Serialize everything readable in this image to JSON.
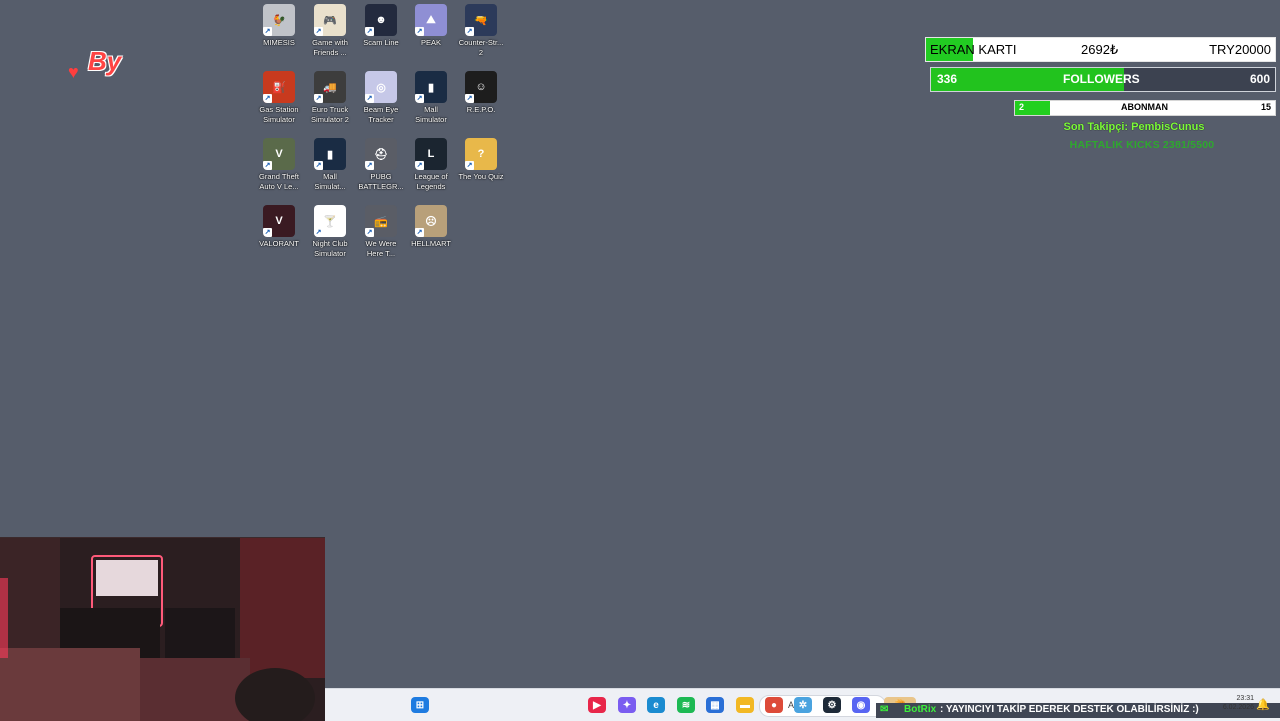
{
  "desktop": {
    "icons": [
      {
        "label": "MIMESIS",
        "icon": "mimesis-icon",
        "color": "#c0c3c9",
        "glyph": "🐓"
      },
      {
        "label": "Game with\nFriends ...",
        "icon": "game-with-friends-icon",
        "color": "#e9e0cc",
        "glyph": "🎮"
      },
      {
        "label": "Scam Line",
        "icon": "scam-line-icon",
        "color": "#232a3e",
        "glyph": "☻"
      },
      {
        "label": "PEAK",
        "icon": "peak-icon",
        "color": "#8f8fd4",
        "glyph": "⛰"
      },
      {
        "label": "Counter-Str...\n2",
        "icon": "counter-strike-icon",
        "color": "#2c3a5a",
        "glyph": "🔫"
      },
      {
        "label": "Gas Station\nSimulator",
        "icon": "gas-station-icon",
        "color": "#c83a1e",
        "glyph": "⛽"
      },
      {
        "label": "Euro Truck\nSimulator 2",
        "icon": "euro-truck-icon",
        "color": "#3d3d3d",
        "glyph": "🚚"
      },
      {
        "label": "Beam Eye\nTracker",
        "icon": "beam-eye-icon",
        "color": "#c6c8e8",
        "glyph": "◎"
      },
      {
        "label": "Mall\nSimulator",
        "icon": "mall-simulator-icon",
        "color": "#1a2c44",
        "glyph": "▮"
      },
      {
        "label": "R.E.P.O.",
        "icon": "repo-icon",
        "color": "#1d1d1d",
        "glyph": "☺"
      },
      {
        "label": "Grand Theft\nAuto V Le...",
        "icon": "gta-v-icon",
        "color": "#5a6a4a",
        "glyph": "V"
      },
      {
        "label": "Mall\nSimulat...",
        "icon": "mall-simulator-2-icon",
        "color": "#1a2c44",
        "glyph": "▮"
      },
      {
        "label": "PUBG\nBATTLEGR...",
        "icon": "pubg-icon",
        "color": "#5a5d66",
        "glyph": "⛑"
      },
      {
        "label": "League of\nLegends",
        "icon": "league-of-legends-icon",
        "color": "#1b2530",
        "glyph": "L"
      },
      {
        "label": "The You Quiz",
        "icon": "you-quiz-icon",
        "color": "#e8b84a",
        "glyph": "?"
      },
      {
        "label": "VALORANT",
        "icon": "valorant-icon",
        "color": "#3a1a22",
        "glyph": "V"
      },
      {
        "label": "Night Club\nSimulator",
        "icon": "night-club-icon",
        "color": "#ffffff",
        "glyph": "🍸"
      },
      {
        "label": "We Were\nHere T...",
        "icon": "we-were-here-icon",
        "color": "#5a5d66",
        "glyph": "📻"
      },
      {
        "label": "HELLMART",
        "icon": "hellmart-icon",
        "color": "#b8a07a",
        "glyph": "☹"
      }
    ]
  },
  "overlay": {
    "logo_text": "By",
    "ekran": {
      "label": "EKRAN KARTI",
      "current": "2692₺",
      "goal": "TRY20000",
      "progress": 0.136
    },
    "followers": {
      "current": "336",
      "label": "FOLLOWERS",
      "goal": "600",
      "progress": 0.56
    },
    "abonman": {
      "current": "2",
      "label": "ABONMAN",
      "goal": "15",
      "progress": 0.133
    },
    "son_takipci": "Son Takipçi: PembisCunus",
    "haftalik": "HAFTALIK KICKS 2381/5500",
    "botrix_name": "BotRix",
    "botrix_message": ": YAYINCIYI TAKİP EDEREK DESTEK OLABİLİRSİNİZ :)"
  },
  "taskbar": {
    "search_placeholder": "Ara",
    "time": "23:31",
    "date": "6.02.2026",
    "apps": [
      {
        "name": "start-icon",
        "color": "#1e7be0",
        "glyph": "⊞"
      },
      {
        "name": "media-player-icon",
        "color": "#e8264a",
        "glyph": "▶"
      },
      {
        "name": "copilot-icon",
        "color": "#7a5cf0",
        "glyph": "✦"
      },
      {
        "name": "edge-icon",
        "color": "#1b8bd0",
        "glyph": "e"
      },
      {
        "name": "spotify-icon",
        "color": "#1db954",
        "glyph": "≋"
      },
      {
        "name": "store-icon",
        "color": "#2a6fd6",
        "glyph": "▦"
      },
      {
        "name": "file-explorer-icon",
        "color": "#f2b824",
        "glyph": "▬"
      },
      {
        "name": "chrome-icon",
        "color": "#dd4b39",
        "glyph": "●"
      },
      {
        "name": "network-app-icon",
        "color": "#4aa3df",
        "glyph": "✲"
      },
      {
        "name": "steam-icon",
        "color": "#1e2a38",
        "glyph": "⚙"
      },
      {
        "name": "discord-icon",
        "color": "#5865f2",
        "glyph": "◉"
      }
    ]
  }
}
